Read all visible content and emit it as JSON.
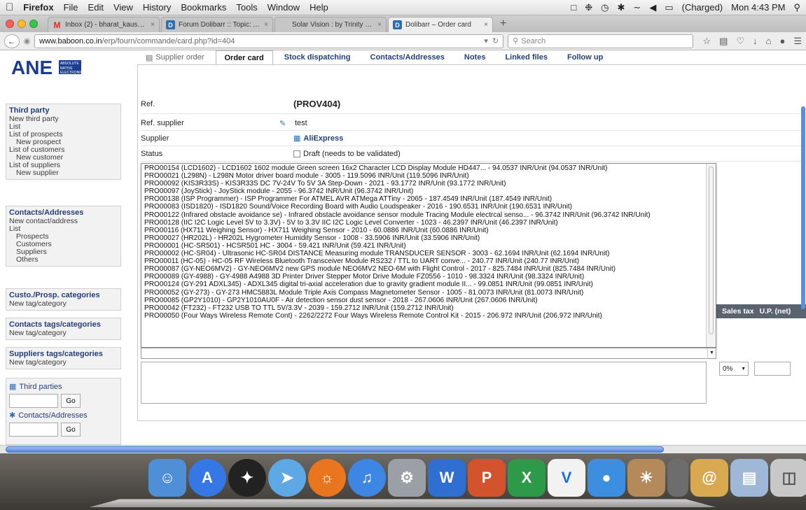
{
  "menubar": {
    "app": "Firefox",
    "items": [
      "File",
      "Edit",
      "View",
      "History",
      "Bookmarks",
      "Tools",
      "Window",
      "Help"
    ],
    "battery": "(Charged)",
    "clock": "Mon 4:43 PM"
  },
  "tabs": [
    {
      "label": "Inbox (2) - bharat_kaushi...",
      "icon": "gmail-icon",
      "color": "#d93025"
    },
    {
      "label": "Forum Dolibarr :: Topic: A...",
      "icon": "dolibarr-icon",
      "color": "#2c6db5"
    },
    {
      "label": "Solar Vision : by Trinity Touch...",
      "icon": "page-icon",
      "color": "#999999"
    },
    {
      "label": "Dolibarr – Order card",
      "icon": "dolibarr-icon",
      "color": "#2c6db5"
    }
  ],
  "nav": {
    "url_host": "www.baboon.co.in",
    "url_path": "/erp/fourn/commande/card.php?id=404",
    "search_placeholder": "Search"
  },
  "sidebar": {
    "third_party": {
      "title": "Third party",
      "items": [
        "New third party",
        "List",
        "List of prospects",
        "New prospect",
        "List of customers",
        "New customer",
        "List of suppliers",
        "New supplier"
      ]
    },
    "contacts": {
      "title": "Contacts/Addresses",
      "items": [
        "New contact/address",
        "List",
        "Prospects",
        "Customers",
        "Suppliers",
        "Others"
      ]
    },
    "custo_cat": {
      "title": "Custo./Prosp. categories",
      "item": "New tag/category"
    },
    "contacts_cat": {
      "title": "Contacts tags/categories",
      "item": "New tag/category"
    },
    "suppliers_cat": {
      "title": "Suppliers tags/categories",
      "item": "New tag/category"
    },
    "quick": {
      "third_parties": "Third parties",
      "contacts": "Contacts/Addresses",
      "go": "Go"
    }
  },
  "page_tabs": [
    "Supplier order",
    "Order card",
    "Stock dispatching",
    "Contacts/Addresses",
    "Notes",
    "Linked files",
    "Follow up"
  ],
  "fields": {
    "ref_label": "Ref.",
    "ref_value": "(PROV404)",
    "ref_supplier_label": "Ref. supplier",
    "ref_supplier_value": "test",
    "supplier_label": "Supplier",
    "supplier_value": "AliExpress",
    "status_label": "Status",
    "status_value": "Draft (needs to be validated)"
  },
  "products": [
    "PRO00154 (LCD1602) - LCD1602 1602 module Green screen 16x2 Character LCD Display Module HD447... - 94.0537 INR/Unit (94.0537 INR/Unit)",
    "PRO00021 (L298N) - L298N Motor driver board module - 3005 - 119.5096 INR/Unit (119.5096 INR/Unit)",
    "PRO00092 (KIS3R33S) - KIS3R33S DC 7V-24V To 5V 3A Step-Down - 2021 - 93.1772 INR/Unit (93.1772 INR/Unit)",
    "PRO00097 (JoyStick) - JoyStick module - 2055 - 96.3742 INR/Unit (96.3742 INR/Unit)",
    "PRO00138 (ISP Programmer) - ISP Programmer For ATMEL AVR ATMega ATTiny - 2065 - 187.4549 INR/Unit (187.4549 INR/Unit)",
    "PRO00083 (ISD1820) - ISD1820 Sound/Voice Recording Board with Audio Loudspeaker - 2016 - 190.6531 INR/Unit (190.6531 INR/Unit)",
    "PRO00122 (Infrared obstacle avoidance se) - Infrared obstacle avoidance sensor module Tracing Module electrcal senso... - 96.3742 INR/Unit (96.3742 INR/Unit)",
    "PRO00128 (IIC I2C Logic Level 5V to 3.3V) - 5V to 3.3V IIC I2C Logic Level Converter - 1023 - 46.2397 INR/Unit (46.2397 INR/Unit)",
    "PRO00116 (HX711 Weighing Sensor) - HX711 Weighing Sensor - 2010 - 60.0886 INR/Unit (60.0886 INR/Unit)",
    "PRO00027 (HR202L) - HR202L Hygrometer Humidity Sensor - 1008 - 33.5906 INR/Unit (33.5906 INR/Unit)",
    "PRO00001 (HC-SR501) - HCSR501 HC - 3004 - 59.421 INR/Unit (59.421 INR/Unit)",
    "PRO00002 (HC-SR04) - Ultrasonic HC-SR04 DISTANCE Measuring module TRANSDUCER SENSOR - 3003 - 62.1694 INR/Unit (62.1694 INR/Unit)",
    "PRO00011 (HC-05) - HC-05 RF Wireless Bluetooth Transceiver Module RS232 / TTL to UART conve... - 240.77 INR/Unit (240.77 INR/Unit)",
    "PRO00087 (GY-NEO6MV2) - GY-NEO6MV2 new GPS module NEO6MV2 NEO-6M with Flight Control - 2017 - 825.7484 INR/Unit (825.7484 INR/Unit)",
    "PRO00089 (GY-4988) - GY-4988 A4988 3D Printer Driver Stepper Motor Drive Module FZ0556 - 1010 - 98.3324 INR/Unit (98.3324 INR/Unit)",
    "PRO00124 (GY-291 ADXL345) - ADXL345 digital tri-axial acceleration due to gravity gradient module II... - 99.0851 INR/Unit (99.0851 INR/Unit)",
    "PRO00052 (GY-273) - GY-273 HMC5883L Module Triple Axis Compass Magnetometer Sensor - 1005 - 81.0073 INR/Unit (81.0073 INR/Unit)",
    "PRO00085 (GP2Y1010) - GP2Y1010AU0F - Air detection sensor dust sensor - 2018 - 267.0606 INR/Unit (267.0606 INR/Unit)",
    "PRO00042 (FT232) - FT232 USB TO TTL 5V/3.3V - 2039 - 159.2712 INR/Unit (159.2712 INR/Unit)",
    "PRO00050 (Four Ways Wireless Remote Cont) - 2262/2272 Four Ways Wireless Remote Control Kit - 2015 - 206.972 INR/Unit (206.972 INR/Unit)"
  ],
  "lines_header": {
    "sales_tax": "Sales tax",
    "up_net": "U.P. (net)"
  },
  "vat_value": "0%"
}
